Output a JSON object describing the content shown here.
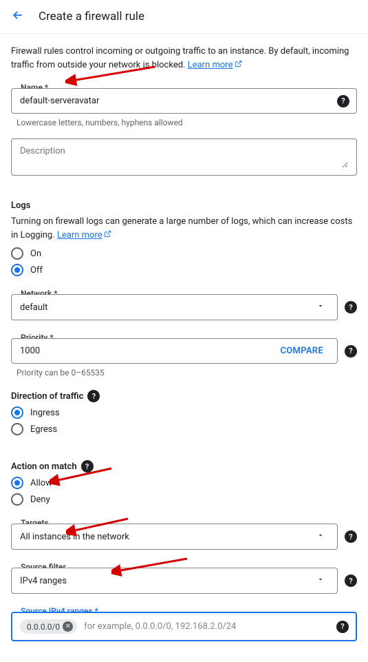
{
  "header": {
    "title": "Create a firewall rule"
  },
  "intro": {
    "text": "Firewall rules control incoming or outgoing traffic to an instance. By default, incoming traffic from outside your network is blocked.",
    "learn_more": "Learn more"
  },
  "name": {
    "label": "Name",
    "value": "default-serveravatar",
    "hint": "Lowercase letters, numbers, hyphens allowed"
  },
  "description": {
    "placeholder": "Description"
  },
  "logs": {
    "title": "Logs",
    "desc": "Turning on firewall logs can generate a large number of logs, which can increase costs in Logging.",
    "learn_more": "Learn more",
    "on_label": "On",
    "off_label": "Off"
  },
  "network": {
    "label": "Network",
    "value": "default"
  },
  "priority": {
    "label": "Priority",
    "value": "1000",
    "compare": "COMPARE",
    "hint": "Priority can be 0–65535"
  },
  "direction": {
    "title": "Direction of traffic",
    "ingress": "Ingress",
    "egress": "Egress"
  },
  "action": {
    "title": "Action on match",
    "allow": "Allow",
    "deny": "Deny"
  },
  "targets": {
    "label": "Targets",
    "value": "All instances in the network"
  },
  "source_filter": {
    "label": "Source filter",
    "value": "IPv4 ranges"
  },
  "source_ranges": {
    "label": "Source IPv4 ranges",
    "chip": "0.0.0.0/0",
    "placeholder": "for example, 0.0.0.0/0, 192.168.2.0/24"
  }
}
